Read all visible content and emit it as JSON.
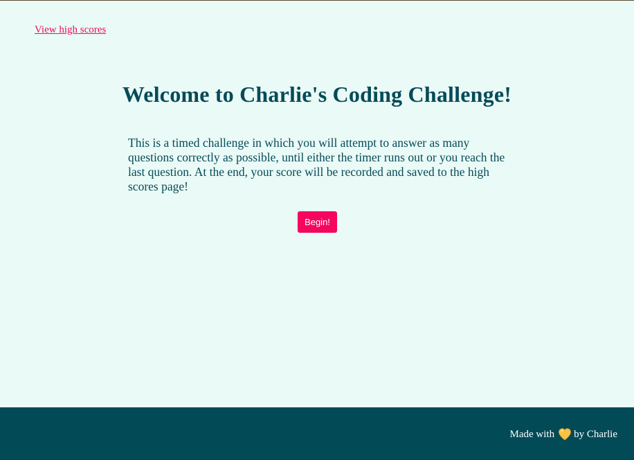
{
  "nav": {
    "high_scores_link": "View high scores"
  },
  "main": {
    "title": "Welcome to Charlie's Coding Challenge!",
    "intro": "This is a timed challenge in which you will attempt to answer as many questions correctly as possible, until either the timer runs out or you reach the last question. At the end, your score will be recorded and saved to the high scores page!",
    "begin_button": "Begin!"
  },
  "footer": {
    "made_with": "Made with",
    "heart_icon": "yellow-heart-icon",
    "by_author": "by Charlie"
  },
  "colors": {
    "background": "#eafaf7",
    "text": "#064b57",
    "accent": "#f5075f",
    "link": "#e8105e",
    "footer_background": "#034a57",
    "heart": "#f6c445"
  }
}
